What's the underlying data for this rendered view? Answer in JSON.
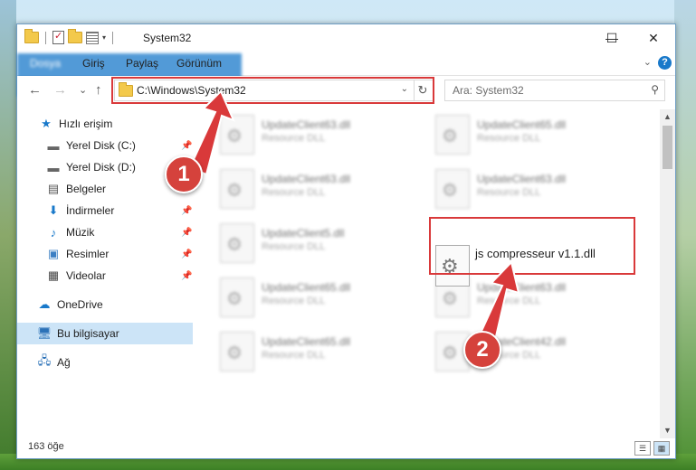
{
  "window": {
    "title": "System32",
    "controls": {
      "minimize": "—",
      "maximize": "☐",
      "close": "✕"
    }
  },
  "ribbon": {
    "tabs": [
      "Dosya",
      "Giriş",
      "Paylaş",
      "Görünüm"
    ],
    "help": "?"
  },
  "nav": {
    "back": "←",
    "forward": "→",
    "recent": "⌄",
    "up": "↑",
    "address": "C:\\Windows\\System32",
    "refresh": "↻",
    "search_placeholder": "Ara: System32"
  },
  "sidebar": {
    "items": [
      {
        "label": "Hızlı erişim",
        "icon": "star-icon"
      },
      {
        "label": "Yerel Disk (C:)",
        "icon": "drive-icon",
        "pinned": true
      },
      {
        "label": "Yerel Disk (D:)",
        "icon": "drive-icon"
      },
      {
        "label": "Belgeler",
        "icon": "documents-icon"
      },
      {
        "label": "İndirmeler",
        "icon": "downloads-icon",
        "pinned": true
      },
      {
        "label": "Müzik",
        "icon": "music-icon",
        "pinned": true
      },
      {
        "label": "Resimler",
        "icon": "pictures-icon",
        "pinned": true
      },
      {
        "label": "Videolar",
        "icon": "videos-icon",
        "pinned": true
      },
      {
        "label": "OneDrive",
        "icon": "cloud-icon"
      },
      {
        "label": "Bu bilgisayar",
        "icon": "computer-icon",
        "selected": true
      },
      {
        "label": "Ağ",
        "icon": "network-icon"
      }
    ]
  },
  "files": [
    {
      "name": "UpdateClient63.dll",
      "type": "Resource DLL"
    },
    {
      "name": "UpdateClient65.dll",
      "type": "Resource DLL"
    },
    {
      "name": "UpdateClient63.dll",
      "type": "Resource DLL"
    },
    {
      "name": "UpdateClient63.dll",
      "type": "Resource DLL"
    },
    {
      "name": "UpdateClient5.dll",
      "type": "Resource DLL"
    },
    {
      "name": "UpdateClient65.dll",
      "type": "Resource DLL"
    },
    {
      "name": "UpdateClient63.dll",
      "type": "Resource DLL"
    },
    {
      "name": "UpdateClient65.dll",
      "type": "Resource DLL"
    },
    {
      "name": "UpdateClient42.dll",
      "type": "Resource DLL"
    }
  ],
  "highlighted_file": {
    "name": "js compresseur v1.1.dll"
  },
  "status": {
    "item_count": "163 öğe"
  },
  "annotations": {
    "badge1": "1",
    "badge2": "2",
    "color": "#d9393a"
  }
}
